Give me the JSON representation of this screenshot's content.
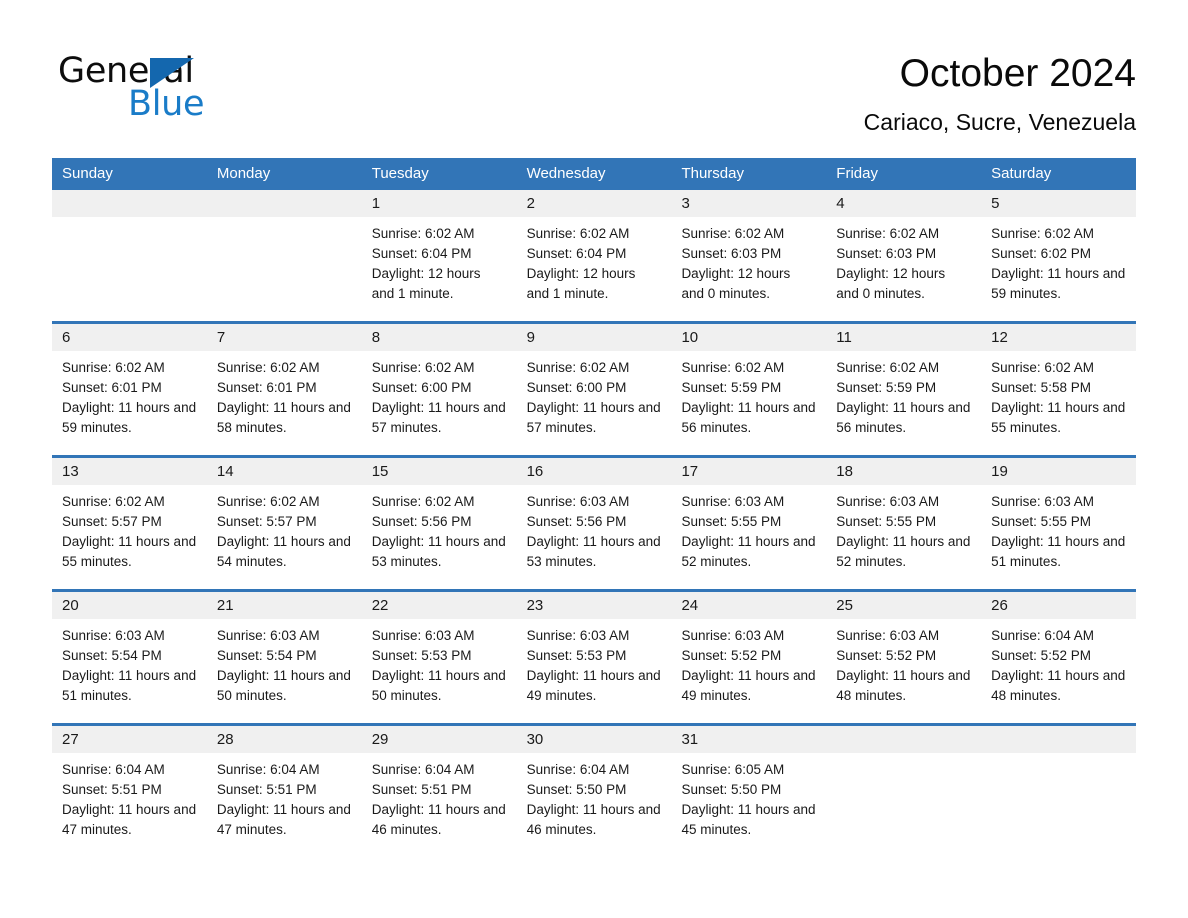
{
  "brand": {
    "name_part1": "General",
    "name_part2": "Blue",
    "triangle_color": "#1467ae",
    "blue_color": "#1a7cc8"
  },
  "header": {
    "month_title": "October 2024",
    "location": "Cariaco, Sucre, Venezuela"
  },
  "theme": {
    "header_blue": "#3275b7",
    "daynum_band": "#f0f0f0",
    "text": "#1a1a1a"
  },
  "weekday_headers": [
    "Sunday",
    "Monday",
    "Tuesday",
    "Wednesday",
    "Thursday",
    "Friday",
    "Saturday"
  ],
  "weeks": [
    [
      {
        "day": "",
        "sunrise": "",
        "sunset": "",
        "daylight": ""
      },
      {
        "day": "",
        "sunrise": "",
        "sunset": "",
        "daylight": ""
      },
      {
        "day": "1",
        "sunrise": "Sunrise: 6:02 AM",
        "sunset": "Sunset: 6:04 PM",
        "daylight": "Daylight: 12 hours and 1 minute."
      },
      {
        "day": "2",
        "sunrise": "Sunrise: 6:02 AM",
        "sunset": "Sunset: 6:04 PM",
        "daylight": "Daylight: 12 hours and 1 minute."
      },
      {
        "day": "3",
        "sunrise": "Sunrise: 6:02 AM",
        "sunset": "Sunset: 6:03 PM",
        "daylight": "Daylight: 12 hours and 0 minutes."
      },
      {
        "day": "4",
        "sunrise": "Sunrise: 6:02 AM",
        "sunset": "Sunset: 6:03 PM",
        "daylight": "Daylight: 12 hours and 0 minutes."
      },
      {
        "day": "5",
        "sunrise": "Sunrise: 6:02 AM",
        "sunset": "Sunset: 6:02 PM",
        "daylight": "Daylight: 11 hours and 59 minutes."
      }
    ],
    [
      {
        "day": "6",
        "sunrise": "Sunrise: 6:02 AM",
        "sunset": "Sunset: 6:01 PM",
        "daylight": "Daylight: 11 hours and 59 minutes."
      },
      {
        "day": "7",
        "sunrise": "Sunrise: 6:02 AM",
        "sunset": "Sunset: 6:01 PM",
        "daylight": "Daylight: 11 hours and 58 minutes."
      },
      {
        "day": "8",
        "sunrise": "Sunrise: 6:02 AM",
        "sunset": "Sunset: 6:00 PM",
        "daylight": "Daylight: 11 hours and 57 minutes."
      },
      {
        "day": "9",
        "sunrise": "Sunrise: 6:02 AM",
        "sunset": "Sunset: 6:00 PM",
        "daylight": "Daylight: 11 hours and 57 minutes."
      },
      {
        "day": "10",
        "sunrise": "Sunrise: 6:02 AM",
        "sunset": "Sunset: 5:59 PM",
        "daylight": "Daylight: 11 hours and 56 minutes."
      },
      {
        "day": "11",
        "sunrise": "Sunrise: 6:02 AM",
        "sunset": "Sunset: 5:59 PM",
        "daylight": "Daylight: 11 hours and 56 minutes."
      },
      {
        "day": "12",
        "sunrise": "Sunrise: 6:02 AM",
        "sunset": "Sunset: 5:58 PM",
        "daylight": "Daylight: 11 hours and 55 minutes."
      }
    ],
    [
      {
        "day": "13",
        "sunrise": "Sunrise: 6:02 AM",
        "sunset": "Sunset: 5:57 PM",
        "daylight": "Daylight: 11 hours and 55 minutes."
      },
      {
        "day": "14",
        "sunrise": "Sunrise: 6:02 AM",
        "sunset": "Sunset: 5:57 PM",
        "daylight": "Daylight: 11 hours and 54 minutes."
      },
      {
        "day": "15",
        "sunrise": "Sunrise: 6:02 AM",
        "sunset": "Sunset: 5:56 PM",
        "daylight": "Daylight: 11 hours and 53 minutes."
      },
      {
        "day": "16",
        "sunrise": "Sunrise: 6:03 AM",
        "sunset": "Sunset: 5:56 PM",
        "daylight": "Daylight: 11 hours and 53 minutes."
      },
      {
        "day": "17",
        "sunrise": "Sunrise: 6:03 AM",
        "sunset": "Sunset: 5:55 PM",
        "daylight": "Daylight: 11 hours and 52 minutes."
      },
      {
        "day": "18",
        "sunrise": "Sunrise: 6:03 AM",
        "sunset": "Sunset: 5:55 PM",
        "daylight": "Daylight: 11 hours and 52 minutes."
      },
      {
        "day": "19",
        "sunrise": "Sunrise: 6:03 AM",
        "sunset": "Sunset: 5:55 PM",
        "daylight": "Daylight: 11 hours and 51 minutes."
      }
    ],
    [
      {
        "day": "20",
        "sunrise": "Sunrise: 6:03 AM",
        "sunset": "Sunset: 5:54 PM",
        "daylight": "Daylight: 11 hours and 51 minutes."
      },
      {
        "day": "21",
        "sunrise": "Sunrise: 6:03 AM",
        "sunset": "Sunset: 5:54 PM",
        "daylight": "Daylight: 11 hours and 50 minutes."
      },
      {
        "day": "22",
        "sunrise": "Sunrise: 6:03 AM",
        "sunset": "Sunset: 5:53 PM",
        "daylight": "Daylight: 11 hours and 50 minutes."
      },
      {
        "day": "23",
        "sunrise": "Sunrise: 6:03 AM",
        "sunset": "Sunset: 5:53 PM",
        "daylight": "Daylight: 11 hours and 49 minutes."
      },
      {
        "day": "24",
        "sunrise": "Sunrise: 6:03 AM",
        "sunset": "Sunset: 5:52 PM",
        "daylight": "Daylight: 11 hours and 49 minutes."
      },
      {
        "day": "25",
        "sunrise": "Sunrise: 6:03 AM",
        "sunset": "Sunset: 5:52 PM",
        "daylight": "Daylight: 11 hours and 48 minutes."
      },
      {
        "day": "26",
        "sunrise": "Sunrise: 6:04 AM",
        "sunset": "Sunset: 5:52 PM",
        "daylight": "Daylight: 11 hours and 48 minutes."
      }
    ],
    [
      {
        "day": "27",
        "sunrise": "Sunrise: 6:04 AM",
        "sunset": "Sunset: 5:51 PM",
        "daylight": "Daylight: 11 hours and 47 minutes."
      },
      {
        "day": "28",
        "sunrise": "Sunrise: 6:04 AM",
        "sunset": "Sunset: 5:51 PM",
        "daylight": "Daylight: 11 hours and 47 minutes."
      },
      {
        "day": "29",
        "sunrise": "Sunrise: 6:04 AM",
        "sunset": "Sunset: 5:51 PM",
        "daylight": "Daylight: 11 hours and 46 minutes."
      },
      {
        "day": "30",
        "sunrise": "Sunrise: 6:04 AM",
        "sunset": "Sunset: 5:50 PM",
        "daylight": "Daylight: 11 hours and 46 minutes."
      },
      {
        "day": "31",
        "sunrise": "Sunrise: 6:05 AM",
        "sunset": "Sunset: 5:50 PM",
        "daylight": "Daylight: 11 hours and 45 minutes."
      },
      {
        "day": "",
        "sunrise": "",
        "sunset": "",
        "daylight": ""
      },
      {
        "day": "",
        "sunrise": "",
        "sunset": "",
        "daylight": ""
      }
    ]
  ]
}
